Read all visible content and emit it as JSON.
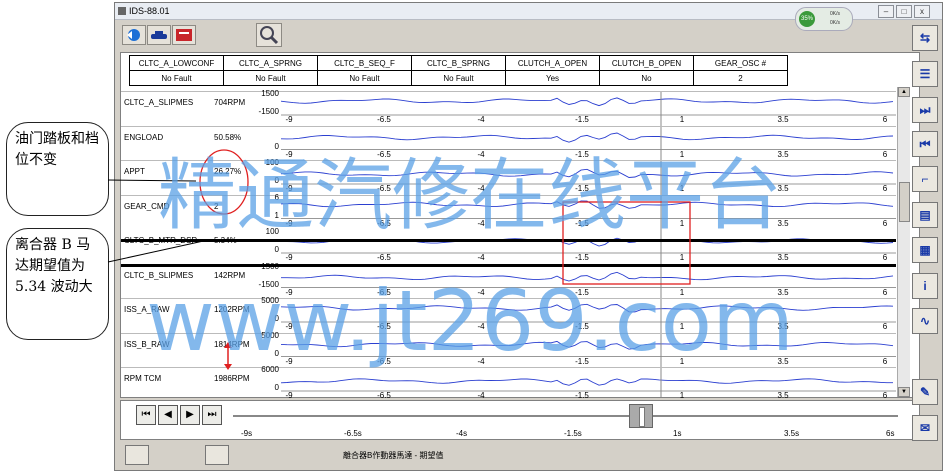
{
  "window": {
    "title": "IDS-88.01"
  },
  "net": {
    "percent": "35%",
    "up": "0K/s",
    "down": "0K/s"
  },
  "header_pids": [
    {
      "name": "CLTC_A_LOWCONF",
      "value": "No Fault"
    },
    {
      "name": "CLTC_A_SPRNG",
      "value": "No Fault"
    },
    {
      "name": "CLTC_B_SEQ_F",
      "value": "No Fault"
    },
    {
      "name": "CLTC_B_SPRNG",
      "value": "No Fault"
    },
    {
      "name": "CLUTCH_A_OPEN",
      "value": "Yes"
    },
    {
      "name": "CLUTCH_B_OPEN",
      "value": "No"
    },
    {
      "name": "GEAR_OSC #",
      "value": "2"
    }
  ],
  "rows": [
    {
      "name": "CLTC_A_SLIPMES",
      "value": "704RPM",
      "ymax": "1500",
      "ymin": "-1500"
    },
    {
      "name": "ENGLOAD",
      "value": "50.58%",
      "ymax": "",
      "ymin": "0"
    },
    {
      "name": "APPT",
      "value": "26.27%",
      "ymax": "100",
      "ymin": "0"
    },
    {
      "name": "GEAR_CMD",
      "value": "2",
      "ymax": "6",
      "ymin": "1"
    },
    {
      "name": "CLTC_B_MTR_DSR",
      "value": "5.34%",
      "ymax": "100",
      "ymin": "0"
    },
    {
      "name": "CLTC_B_SLIPMES",
      "value": "142RPM",
      "ymax": "1500",
      "ymin": "-1500"
    },
    {
      "name": "ISS_A_RAW",
      "value": "1202RPM",
      "ymax": "5000",
      "ymin": "0"
    },
    {
      "name": "ISS_B_RAW",
      "value": "1814RPM",
      "ymax": "5000",
      "ymin": "0"
    },
    {
      "name": "RPM TCM",
      "value": "1986RPM",
      "ymax": "6000",
      "ymin": "0"
    }
  ],
  "row_ticks": [
    "-9",
    "-6.5",
    "-4",
    "-1.5",
    "1",
    "3.5",
    "6"
  ],
  "time_ticks": [
    "-9s",
    "-6.5s",
    "-4s",
    "-1.5s",
    "1s",
    "3.5s",
    "6s"
  ],
  "nav": {
    "first": "⏮",
    "prev": "◀",
    "next": "▶",
    "last": "⏭"
  },
  "status": {
    "text": "離合器B作動器馬達 - 期望值"
  },
  "annotations": {
    "left_top": "油门踏板和档位不变",
    "left_bottom": "离合器 B 马达期望值为 5.34 波动大"
  },
  "watermark": {
    "line1": "精通汽修在线平台",
    "line2": "www.jt269.com"
  },
  "colors": {
    "trace": "#2b3fd0",
    "highlight": "#e02020",
    "watermark": "#5aa0e6"
  }
}
